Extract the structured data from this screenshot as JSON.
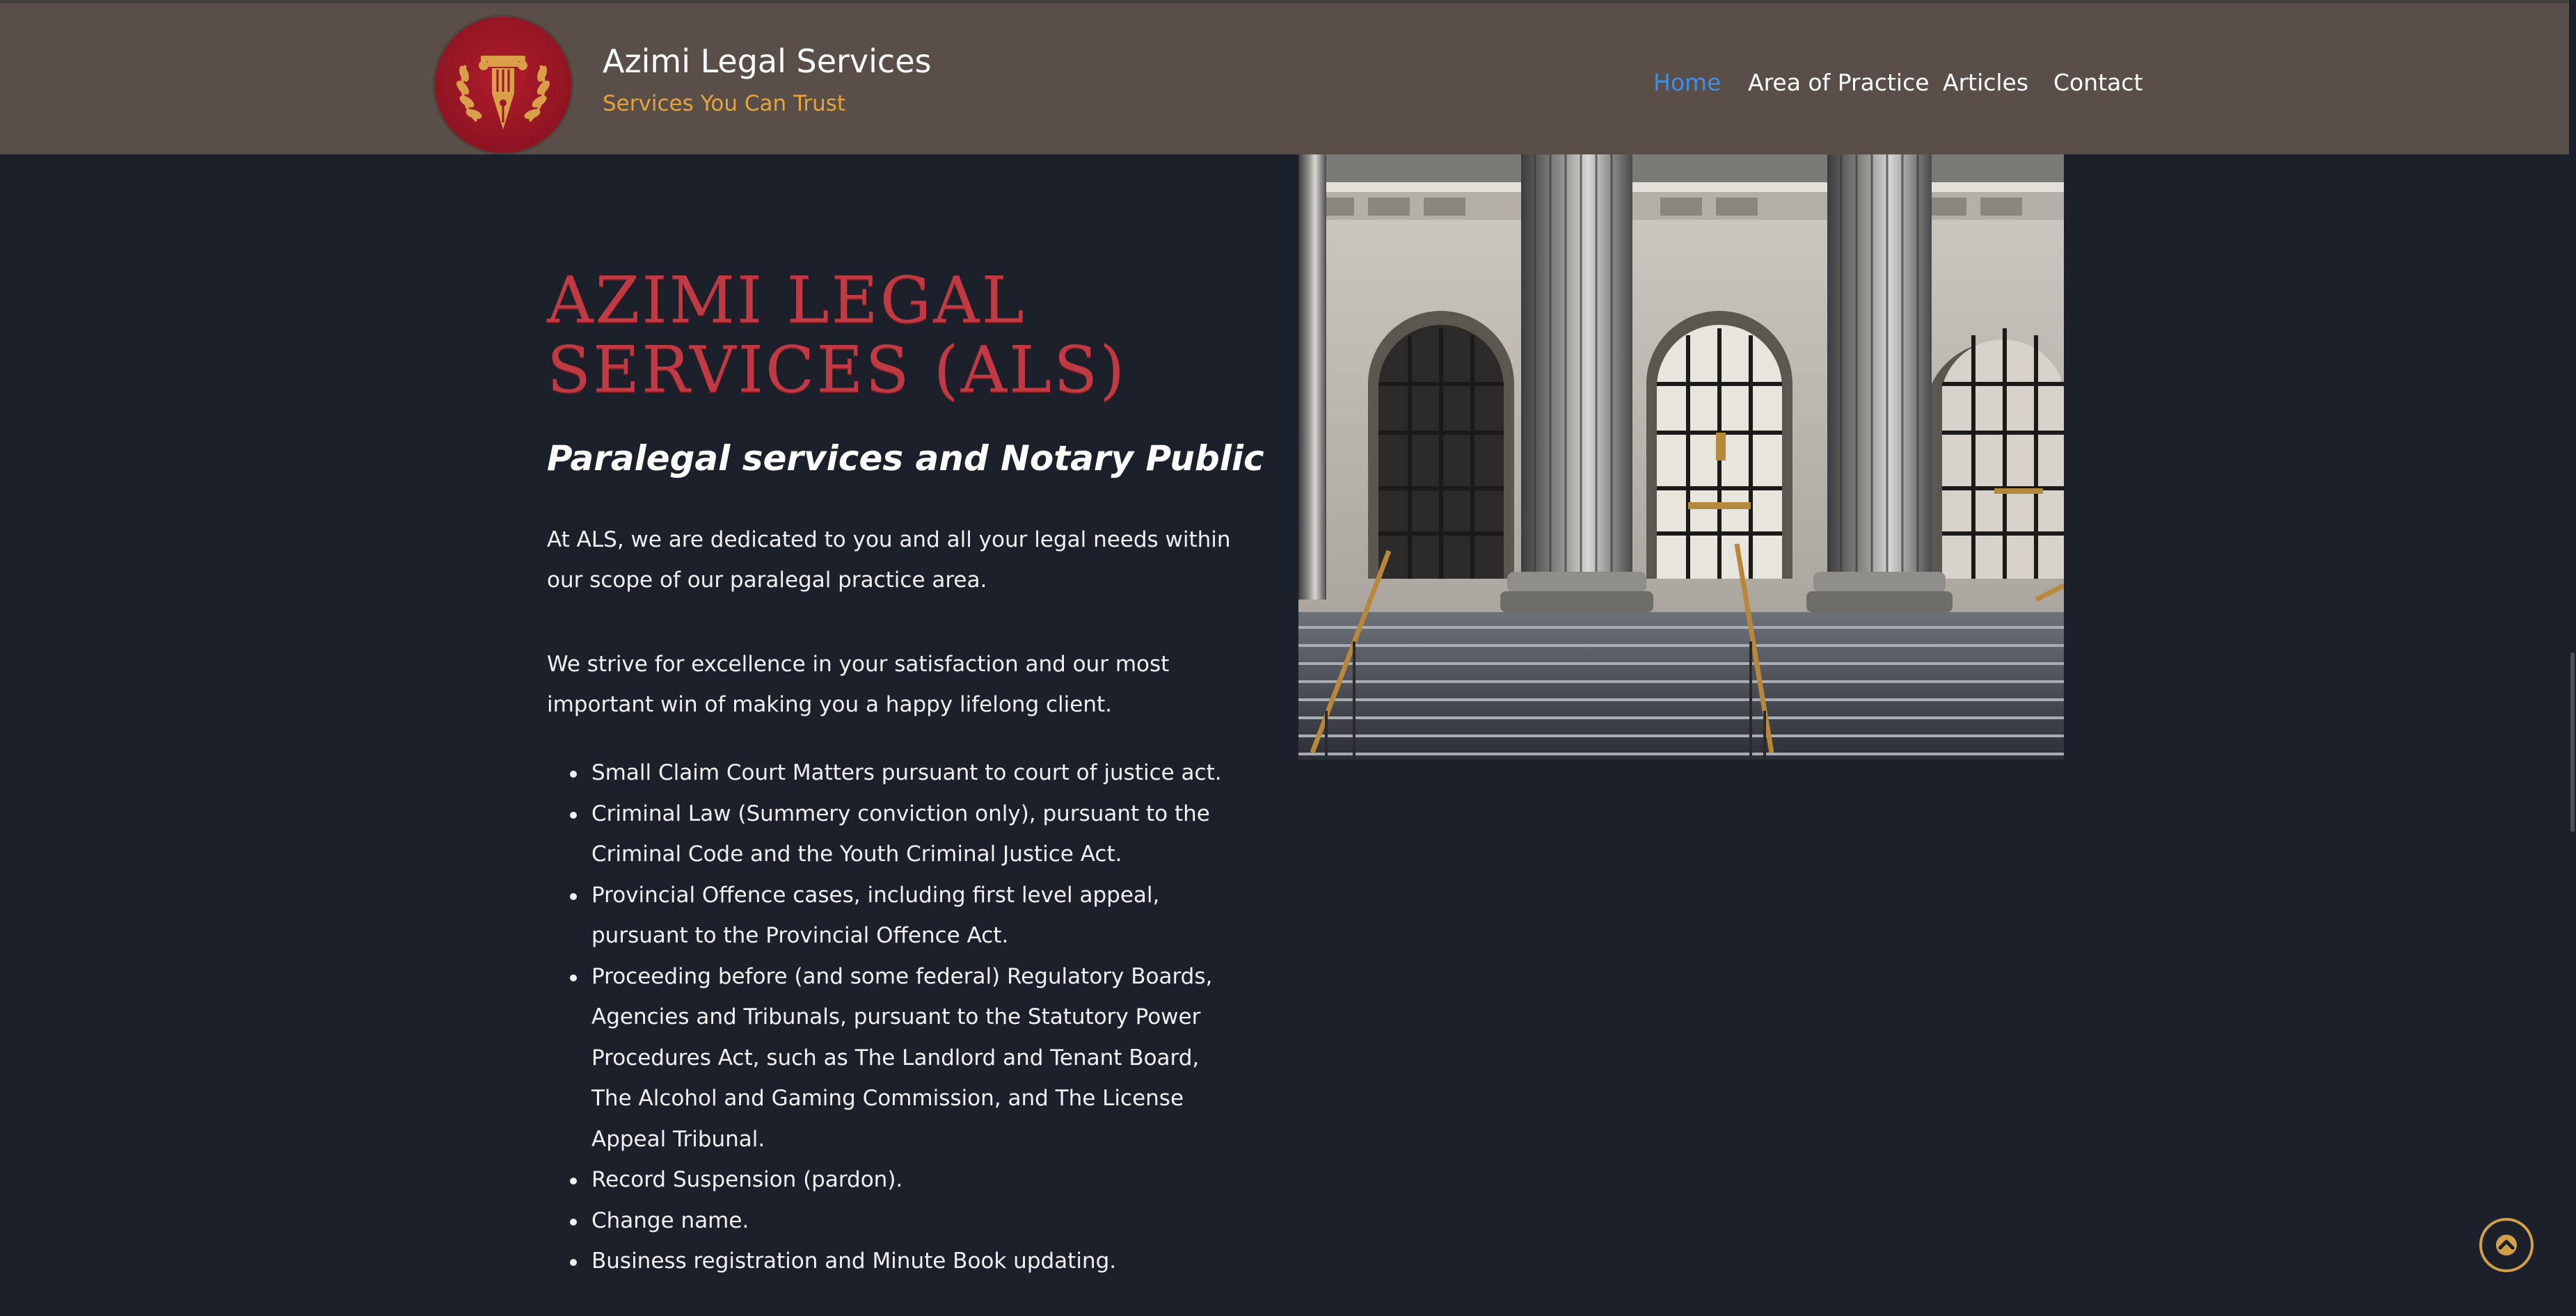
{
  "header": {
    "site_title": "Azimi Legal Services",
    "tagline": "Services You Can Trust",
    "logo_icon": "pen-column-laurel-icon",
    "colors": {
      "header_bg": "#5a4f48",
      "tagline": "#e5a33e",
      "logo_bg": "#9c1726",
      "logo_gold": "#d9a049",
      "nav_active": "#3f8fe8"
    },
    "nav": [
      {
        "label": "Home",
        "active": true
      },
      {
        "label": "Area of Practice",
        "active": false
      },
      {
        "label": "Articles",
        "active": false
      },
      {
        "label": "Contact",
        "active": false
      }
    ]
  },
  "hero": {
    "title": "AZIMI LEGAL SERVICES (ALS)",
    "title_color": "#c03a44",
    "subtitle": "Paralegal services and Notary Public",
    "paragraphs": [
      "At ALS, we are dedicated to you and all your legal needs within our scope of our paralegal  practice area.",
      "We strive for excellence in your satisfaction and our most important win of making you a happy lifelong client."
    ],
    "services": [
      "Small Claim Court Matters pursuant to court of justice act.",
      "Criminal Law (Summery conviction only), pursuant to the Criminal Code and the Youth Criminal Justice Act.",
      "Provincial Offence cases, including first level appeal, pursuant to the Provincial Offence Act.",
      "Proceeding before (and some federal) Regulatory Boards, Agencies and Tribunals, pursuant to the Statutory Power Procedures Act, such as The  Landlord and Tenant Board, The Alcohol and Gaming Commission, and The License Appeal Tribunal.",
      "Record Suspension (pardon).",
      "Change name.",
      "Business registration and Minute Book updating."
    ]
  },
  "image": {
    "subject": "courthouse-columns-photo"
  },
  "page": {
    "background": "#1c202b",
    "back_to_top_icon": "chevron-up-icon",
    "back_to_top_color": "#d2a047"
  }
}
